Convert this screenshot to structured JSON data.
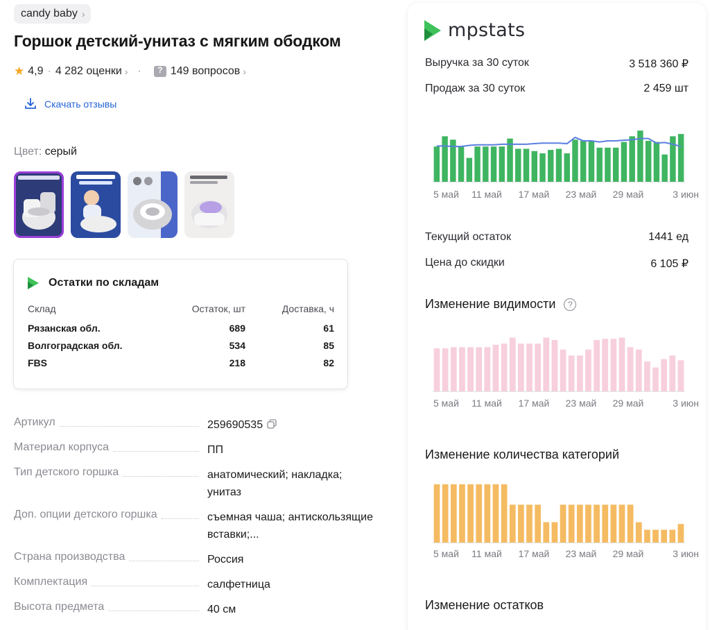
{
  "product": {
    "brand": "candy baby",
    "title": "Горшок детский-унитаз с мягким ободком",
    "rating": "4,9",
    "reviews": "4 282 оценки",
    "questions": "149 вопросов",
    "download_label": "Скачать отзывы",
    "color_label": "Цвет:",
    "color_value": "серый"
  },
  "stock_card": {
    "title": "Остатки по складам",
    "headers": [
      "Склад",
      "Остаток, шт",
      "Доставка, ч"
    ],
    "rows": [
      {
        "name": "Рязанская обл.",
        "stock": "689",
        "delivery": "61"
      },
      {
        "name": "Волгоградская обл.",
        "stock": "534",
        "delivery": "85"
      },
      {
        "name": "FBS",
        "stock": "218",
        "delivery": "82"
      }
    ]
  },
  "specs": [
    {
      "key": "Артикул",
      "value": "259690535"
    },
    {
      "key": "Материал корпуса",
      "value": "ПП"
    },
    {
      "key": "Тип детского горшка",
      "value": "анатомический; накладка; унитаз"
    },
    {
      "key": "Доп. опции детского горшка",
      "value": "съемная чаша; антискользящие вставки;..."
    },
    {
      "key": "Страна производства",
      "value": "Россия"
    },
    {
      "key": "Комплектация",
      "value": "салфетница"
    },
    {
      "key": "Высота предмета",
      "value": "40 см"
    }
  ],
  "mpstats": {
    "logo": "mpstats",
    "revenue_label": "Выручка за 30 суток",
    "revenue_value": "3 518 360 ₽",
    "sales_label": "Продаж за 30 суток",
    "sales_value": "2 459 шт",
    "stock_label": "Текущий остаток",
    "stock_value": "1441 ед",
    "price_label": "Цена до скидки",
    "price_value": "6 105 ₽",
    "visibility_title": "Изменение видимости",
    "categories_title": "Изменение количества категорий",
    "stock_change_title": "Изменение остатков"
  },
  "colors": {
    "sales_bar": "#3fb561",
    "sales_line": "#5b7fe0",
    "visibility_bar": "#f7cfdd",
    "categories_bar": "#f5bb62",
    "accent": "#2563d6",
    "brand_green": "#3fc25a"
  },
  "chart_data": [
    {
      "type": "bar",
      "name": "sales",
      "x_tick_labels": [
        "5 май",
        "11 май",
        "17 май",
        "23 май",
        "29 май",
        "3 июн"
      ],
      "values": [
        62,
        80,
        74,
        62,
        42,
        62,
        62,
        62,
        62,
        76,
        58,
        58,
        54,
        50,
        56,
        58,
        50,
        74,
        72,
        72,
        60,
        60,
        60,
        70,
        80,
        90,
        72,
        70,
        48,
        80,
        84
      ],
      "line": [
        63,
        63,
        62,
        62,
        64,
        65,
        65,
        65,
        66,
        66,
        66,
        66,
        67,
        68,
        68,
        68,
        67,
        78,
        72,
        72,
        70,
        72,
        72,
        73,
        74,
        76,
        76,
        68,
        69,
        66,
        62
      ],
      "ylim": [
        0,
        100
      ]
    },
    {
      "type": "bar",
      "name": "visibility",
      "x_tick_labels": [
        "5 май",
        "11 май",
        "17 май",
        "23 май",
        "29 май",
        "3 июн"
      ],
      "values": [
        72,
        72,
        74,
        74,
        74,
        74,
        74,
        78,
        80,
        90,
        80,
        80,
        80,
        90,
        86,
        70,
        60,
        60,
        70,
        86,
        88,
        88,
        90,
        74,
        70,
        50,
        40,
        54,
        60,
        52
      ],
      "ylim": [
        0,
        100
      ]
    },
    {
      "type": "bar",
      "name": "categories",
      "x_tick_labels": [
        "5 май",
        "11 май",
        "17 май",
        "23 май",
        "29 май",
        "3 июн"
      ],
      "values": [
        10,
        10,
        10,
        10,
        10,
        10,
        10,
        10,
        10,
        6.5,
        6.5,
        6.5,
        6.5,
        3.5,
        3.5,
        6.5,
        6.5,
        6.5,
        6.5,
        6.5,
        6.5,
        6.5,
        6.5,
        6.5,
        3.5,
        2.2,
        2.2,
        2.2,
        2.2,
        3.2
      ],
      "ylim": [
        0,
        10
      ]
    }
  ]
}
